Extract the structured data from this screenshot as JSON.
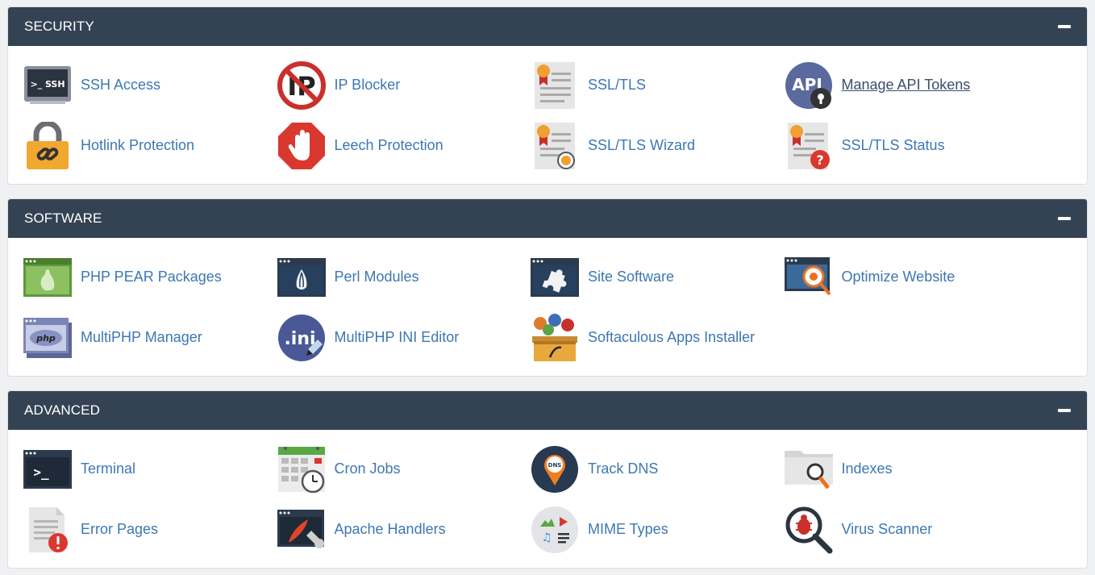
{
  "sections": [
    {
      "title": "SECURITY",
      "items": [
        {
          "label": "SSH Access",
          "icon": "ssh-terminal-icon"
        },
        {
          "label": "IP Blocker",
          "icon": "ip-blocked-icon"
        },
        {
          "label": "SSL/TLS",
          "icon": "certificate-icon"
        },
        {
          "label": "Manage API Tokens",
          "icon": "api-lock-icon"
        },
        {
          "label": "Hotlink Protection",
          "icon": "padlock-link-icon"
        },
        {
          "label": "Leech Protection",
          "icon": "stop-hand-icon"
        },
        {
          "label": "SSL/TLS Wizard",
          "icon": "certificate-wizard-icon"
        },
        {
          "label": "SSL/TLS Status",
          "icon": "certificate-status-icon"
        }
      ]
    },
    {
      "title": "SOFTWARE",
      "items": [
        {
          "label": "PHP PEAR Packages",
          "icon": "pear-window-icon"
        },
        {
          "label": "Perl Modules",
          "icon": "onion-window-icon"
        },
        {
          "label": "Site Software",
          "icon": "puzzle-window-icon"
        },
        {
          "label": "Optimize Website",
          "icon": "optimize-window-icon"
        },
        {
          "label": "MultiPHP Manager",
          "icon": "php-window-icon"
        },
        {
          "label": "MultiPHP INI Editor",
          "icon": "ini-editor-icon"
        },
        {
          "label": "Softaculous Apps Installer",
          "icon": "softaculous-box-icon"
        }
      ]
    },
    {
      "title": "ADVANCED",
      "items": [
        {
          "label": "Terminal",
          "icon": "terminal-icon"
        },
        {
          "label": "Cron Jobs",
          "icon": "calendar-clock-icon"
        },
        {
          "label": "Track DNS",
          "icon": "dns-pin-icon"
        },
        {
          "label": "Indexes",
          "icon": "folder-search-icon"
        },
        {
          "label": "Error Pages",
          "icon": "error-page-icon"
        },
        {
          "label": "Apache Handlers",
          "icon": "feather-wrench-icon"
        },
        {
          "label": "MIME Types",
          "icon": "media-types-icon"
        },
        {
          "label": "Virus Scanner",
          "icon": "bug-magnifier-icon"
        }
      ]
    }
  ],
  "colors": {
    "header_bg": "#344354",
    "link": "#3d77b3",
    "page_bg": "#f0f1f2"
  }
}
